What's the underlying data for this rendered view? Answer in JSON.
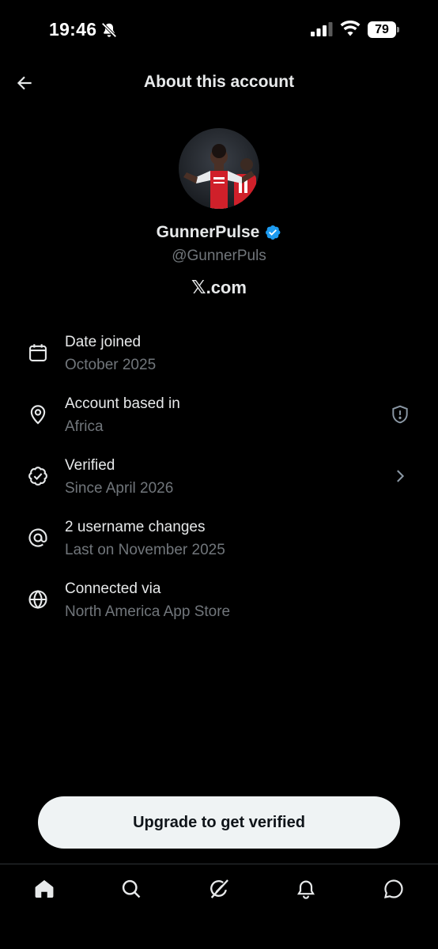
{
  "status_bar": {
    "time": "19:46",
    "battery_level": "79"
  },
  "header": {
    "title": "About this account"
  },
  "profile": {
    "display_name": "GunnerPulse",
    "handle": "@GunnerPuls",
    "site_logo": "𝕏",
    "site_suffix": ".com",
    "verified_color": "#1d9bf0"
  },
  "info_items": [
    {
      "icon": "calendar-icon",
      "title": "Date joined",
      "subtitle": "October 2025"
    },
    {
      "icon": "location-pin-icon",
      "title": "Account based in",
      "subtitle": "Africa",
      "right_icon": "shield-alert-icon"
    },
    {
      "icon": "verified-badge-icon",
      "title": "Verified",
      "subtitle": "Since April 2026",
      "right_icon": "chevron-right-icon"
    },
    {
      "icon": "at-sign-icon",
      "title": "2 username changes",
      "subtitle": "Last on November 2025"
    },
    {
      "icon": "globe-icon",
      "title": "Connected via",
      "subtitle": "North America App Store"
    }
  ],
  "upgrade_button": {
    "label": "Upgrade to get verified"
  },
  "bottom_nav": [
    "home-icon",
    "search-icon",
    "grok-icon",
    "notifications-icon",
    "messages-icon"
  ]
}
